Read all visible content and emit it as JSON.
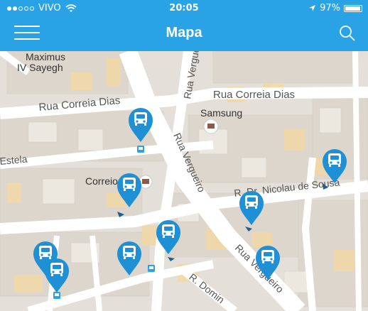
{
  "status_bar": {
    "carrier": "VIVO",
    "time": "20:05",
    "battery": "97%",
    "battery_level": 0.97
  },
  "navbar": {
    "title": "Mapa",
    "menu_icon": "hamburger-icon",
    "search_icon": "search-icon"
  },
  "map": {
    "labels": {
      "maximus_1": "Maximus",
      "maximus_2": "IV Sayegh",
      "rua_correia_dias_left": "Rua Correia Dias",
      "rua_correia_dias_right": "Rua Correia Dias",
      "rua_vergueiro_top": "Rua Vergue",
      "rua_vergueiro_mid": "Rua Vergueiro",
      "rua_vergueiro_bottom": "Rua Vergueiro",
      "samsung": "Samsung",
      "estela": "Estela",
      "correios": "Correio",
      "nicolau": "R. Dr. Nicolau de Sousa",
      "r_domingos": "R. Domin"
    },
    "pin_icon": "bus-stop-pin-icon",
    "colors": {
      "pin": "#1f8fd6",
      "road": "#ffffff",
      "block": "#ddd8ce",
      "building": "#f4dca6"
    }
  }
}
